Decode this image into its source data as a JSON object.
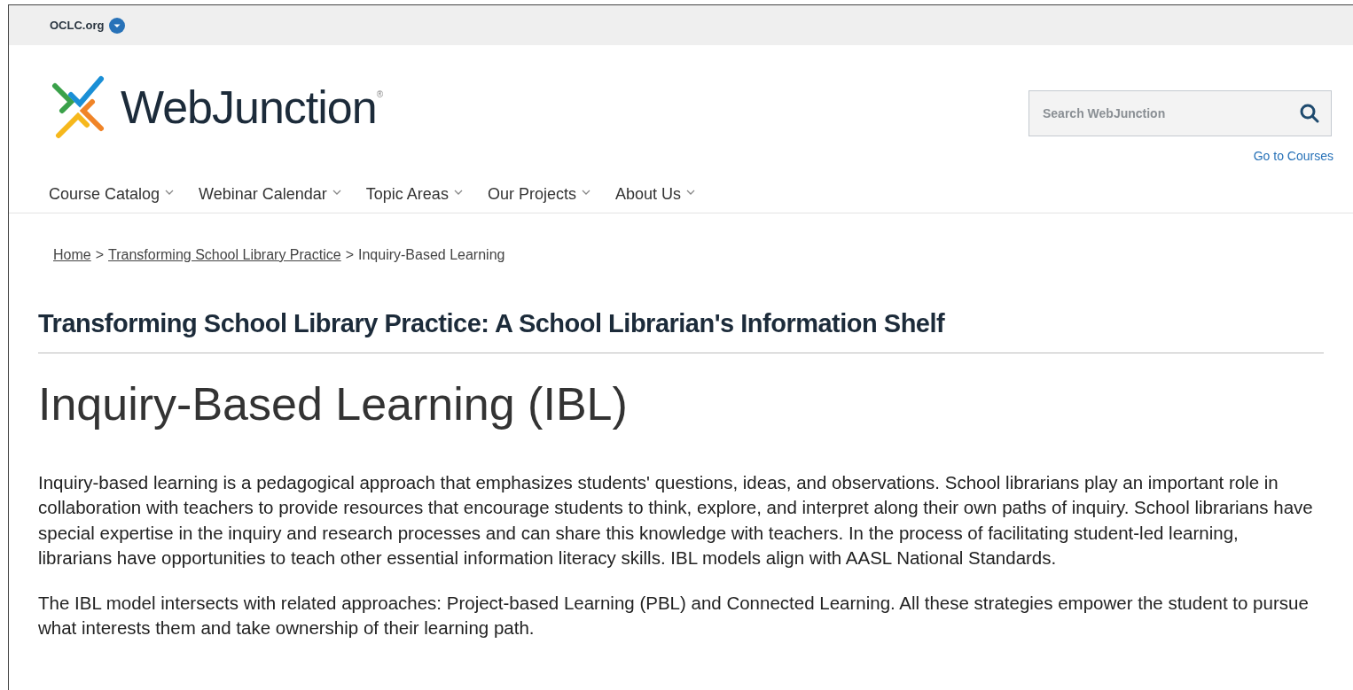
{
  "top_bar": {
    "org_link": "OCLC.org"
  },
  "header": {
    "logo_text": "WebJunction",
    "logo_mark": "®",
    "search": {
      "placeholder": "Search WebJunction"
    },
    "courses_link": "Go to Courses"
  },
  "nav": [
    {
      "label": "Course Catalog"
    },
    {
      "label": "Webinar Calendar"
    },
    {
      "label": "Topic Areas"
    },
    {
      "label": "Our Projects"
    },
    {
      "label": "About Us"
    }
  ],
  "breadcrumb": [
    {
      "kind": "link",
      "text": "Home"
    },
    {
      "kind": "separator",
      "text": ">"
    },
    {
      "kind": "link",
      "text": "Transforming School Library Practice"
    },
    {
      "kind": "separator",
      "text": ">"
    },
    {
      "kind": "current",
      "text": "Inquiry-Based Learning"
    }
  ],
  "section_title": "Transforming School Library Practice: A School Librarian's Information Shelf",
  "title": "Inquiry-Based Learning (IBL)",
  "paragraphs": [
    "Inquiry-based learning is a pedagogical approach that emphasizes students' questions, ideas, and observations. School librarians play an important role in collaboration with teachers to provide resources that encourage students to think, explore, and interpret along their own paths of inquiry. School librarians have special expertise in the inquiry and research processes and can share this knowledge with teachers. In the process of facilitating student-led learning, librarians have opportunities to teach other essential information literacy skills. IBL models align with AASL National Standards.",
    "The IBL model intersects with related approaches: Project-based Learning (PBL) and Connected Learning. All these strategies empower the student to pursue what interests them and take ownership of their learning path."
  ]
}
